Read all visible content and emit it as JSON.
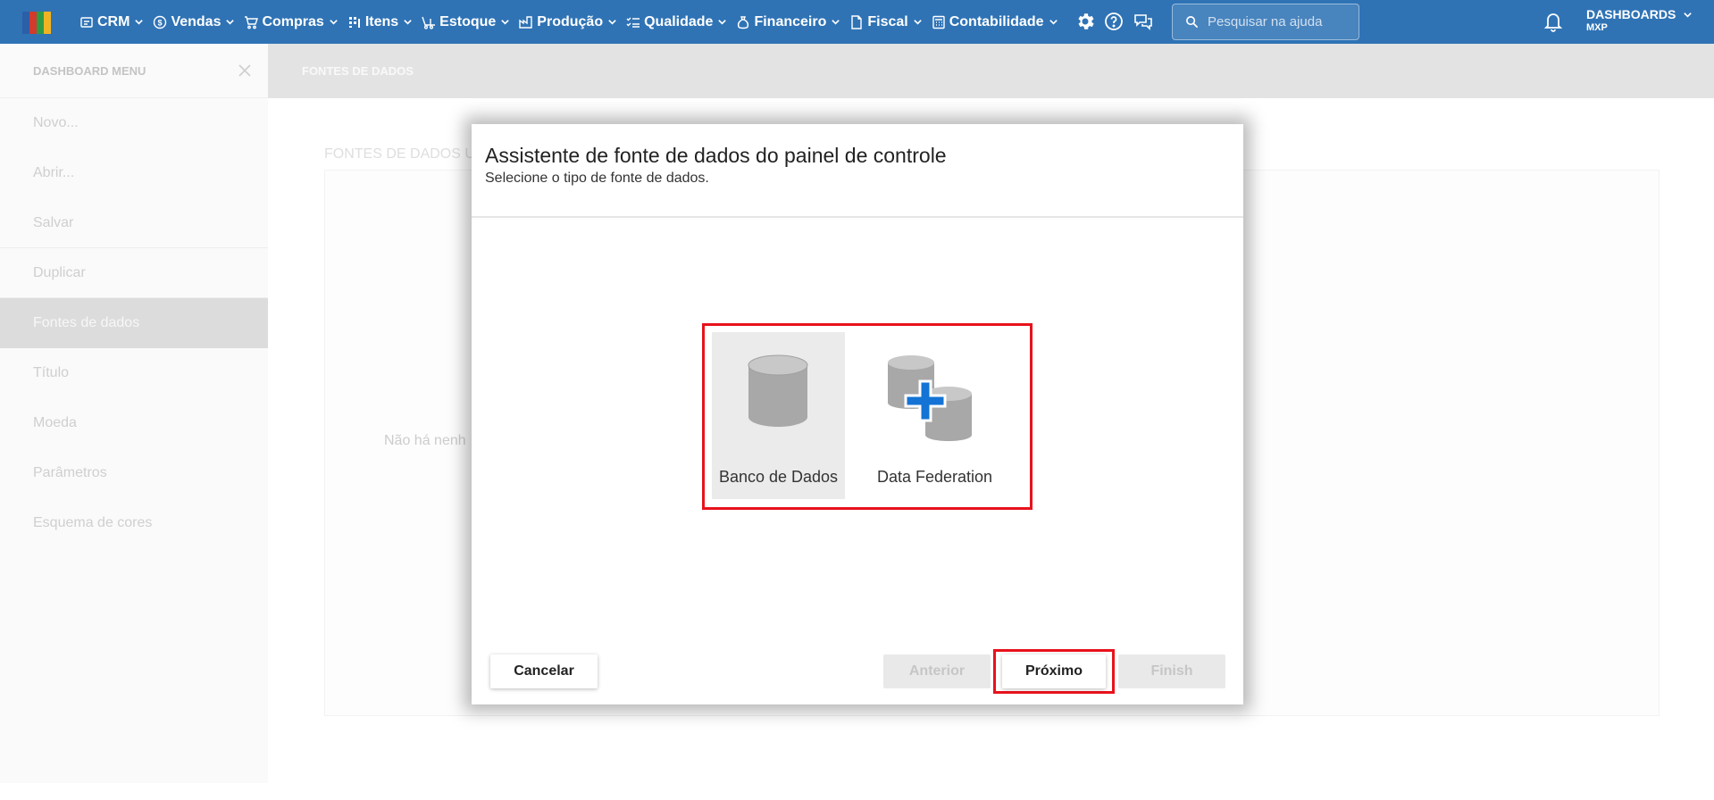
{
  "topbar": {
    "logo_colors": [
      "#2c5fa8",
      "#d23a2c",
      "#2f9b45",
      "#f0b323"
    ],
    "menu": [
      {
        "label": "CRM",
        "icon": "crm-icon"
      },
      {
        "label": "Vendas",
        "icon": "dollar-icon"
      },
      {
        "label": "Compras",
        "icon": "cart-icon"
      },
      {
        "label": "Itens",
        "icon": "items-icon"
      },
      {
        "label": "Estoque",
        "icon": "forklift-icon"
      },
      {
        "label": "Produção",
        "icon": "factory-icon"
      },
      {
        "label": "Qualidade",
        "icon": "checklist-icon"
      },
      {
        "label": "Financeiro",
        "icon": "moneybag-icon"
      },
      {
        "label": "Fiscal",
        "icon": "document-icon"
      },
      {
        "label": "Contabilidade",
        "icon": "calculator-icon"
      }
    ],
    "search_placeholder": "Pesquisar na ajuda",
    "user_title": "DASHBOARDS",
    "user_subtitle": "MXP"
  },
  "sidebar": {
    "title": "DASHBOARD MENU",
    "items": [
      {
        "label": "Novo..."
      },
      {
        "label": "Abrir..."
      },
      {
        "label": "Salvar"
      },
      {
        "label": "Duplicar"
      },
      {
        "label": "Fontes de dados"
      },
      {
        "label": "Título"
      },
      {
        "label": "Moeda"
      },
      {
        "label": "Parâmetros"
      },
      {
        "label": "Esquema de cores"
      }
    ],
    "active_item": "Fontes de dados"
  },
  "main": {
    "header": "FONTES DE DADOS",
    "section_label": "FONTES DE DADOS U",
    "empty_message": "Não há nenh"
  },
  "dialog": {
    "title": "Assistente de fonte de dados do painel de controle",
    "subtitle": "Selecione o tipo de fonte de dados.",
    "options": [
      {
        "label": "Banco de Dados",
        "icon": "database-icon",
        "selected": true
      },
      {
        "label": "Data Federation",
        "icon": "data-federation-icon",
        "selected": false
      }
    ],
    "buttons": {
      "cancel": "Cancelar",
      "previous": "Anterior",
      "next": "Próximo",
      "finish": "Finish"
    },
    "highlight_color": "#e8121c"
  }
}
